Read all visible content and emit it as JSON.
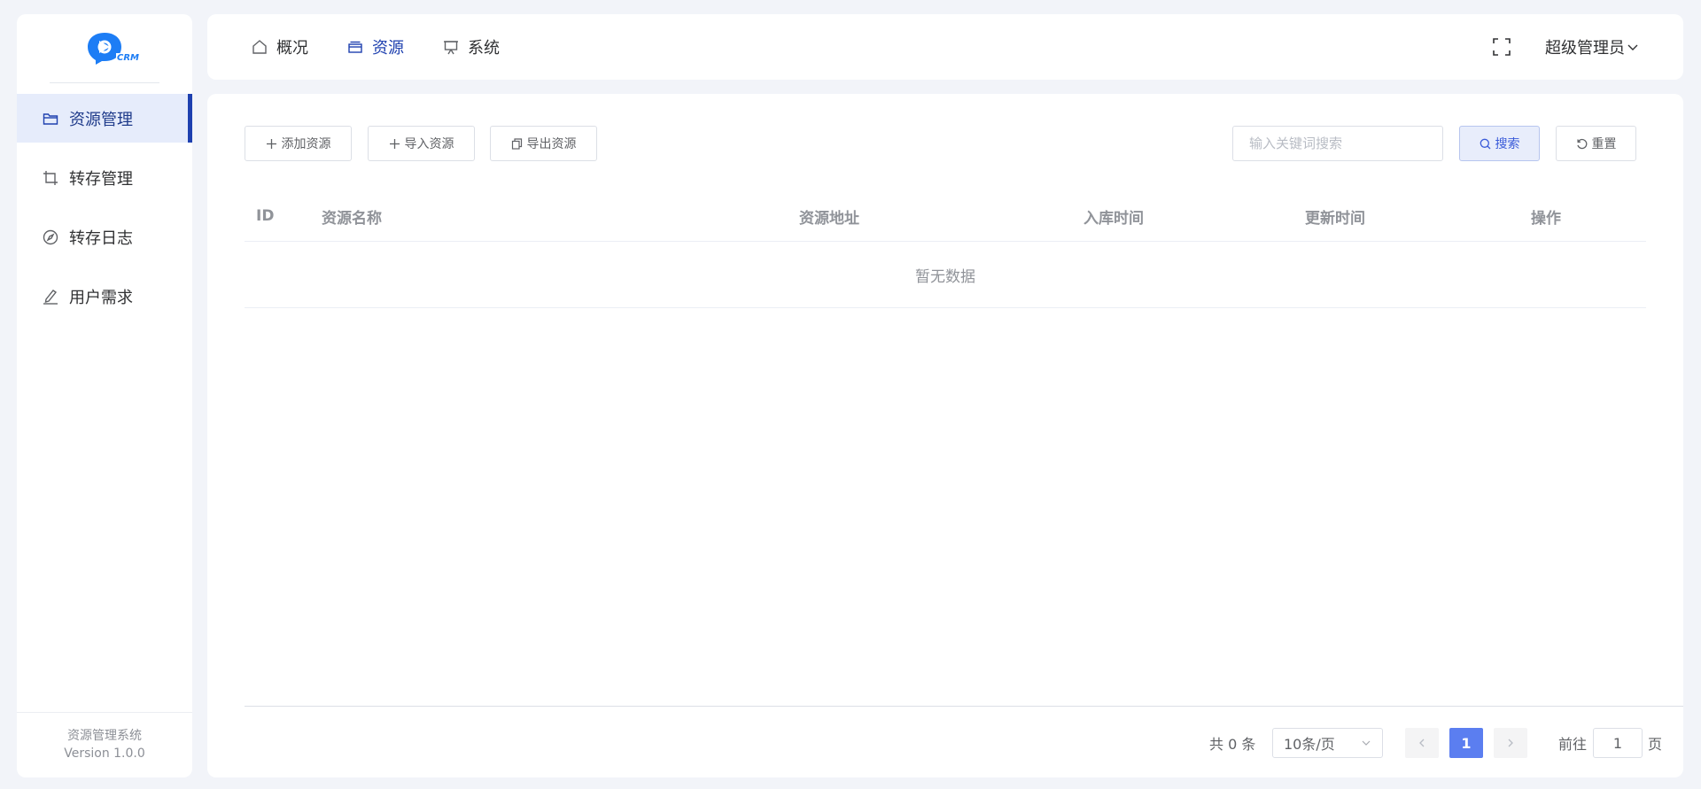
{
  "sidebar": {
    "logo_text": "CRM",
    "items": [
      {
        "label": "资源管理",
        "icon": "folder-icon",
        "active": true
      },
      {
        "label": "转存管理",
        "icon": "crop-icon"
      },
      {
        "label": "转存日志",
        "icon": "compass-icon"
      },
      {
        "label": "用户需求",
        "icon": "edit-pen-icon"
      }
    ],
    "footer": {
      "system_name": "资源管理系统",
      "version": "Version 1.0.0"
    }
  },
  "topbar": {
    "menu": [
      {
        "label": "概况",
        "icon": "home-icon"
      },
      {
        "label": "资源",
        "icon": "box-icon",
        "active": true
      },
      {
        "label": "系统",
        "icon": "monitor-icon"
      }
    ],
    "fullscreen_icon": "fullscreen-icon",
    "user_name": "超级管理员"
  },
  "toolbar": {
    "add_label": "添加资源",
    "import_label": "导入资源",
    "export_label": "导出资源",
    "search_placeholder": "输入关键词搜索",
    "search_value": "",
    "search_label": "搜索",
    "reset_label": "重置"
  },
  "table": {
    "columns": [
      "ID",
      "资源名称",
      "资源地址",
      "入库时间",
      "更新时间",
      "操作"
    ],
    "rows": [],
    "empty_text": "暂无数据"
  },
  "pagination": {
    "total_text": "共 0 条",
    "page_size": "10条/页",
    "current_page": "1",
    "goto_label": "前往",
    "goto_value": "1",
    "page_suffix": "页"
  },
  "colors": {
    "accent": "#1e40af",
    "active_bg": "#e6ecfb",
    "page_active": "#5b7ef0",
    "background": "#f2f4f9"
  }
}
